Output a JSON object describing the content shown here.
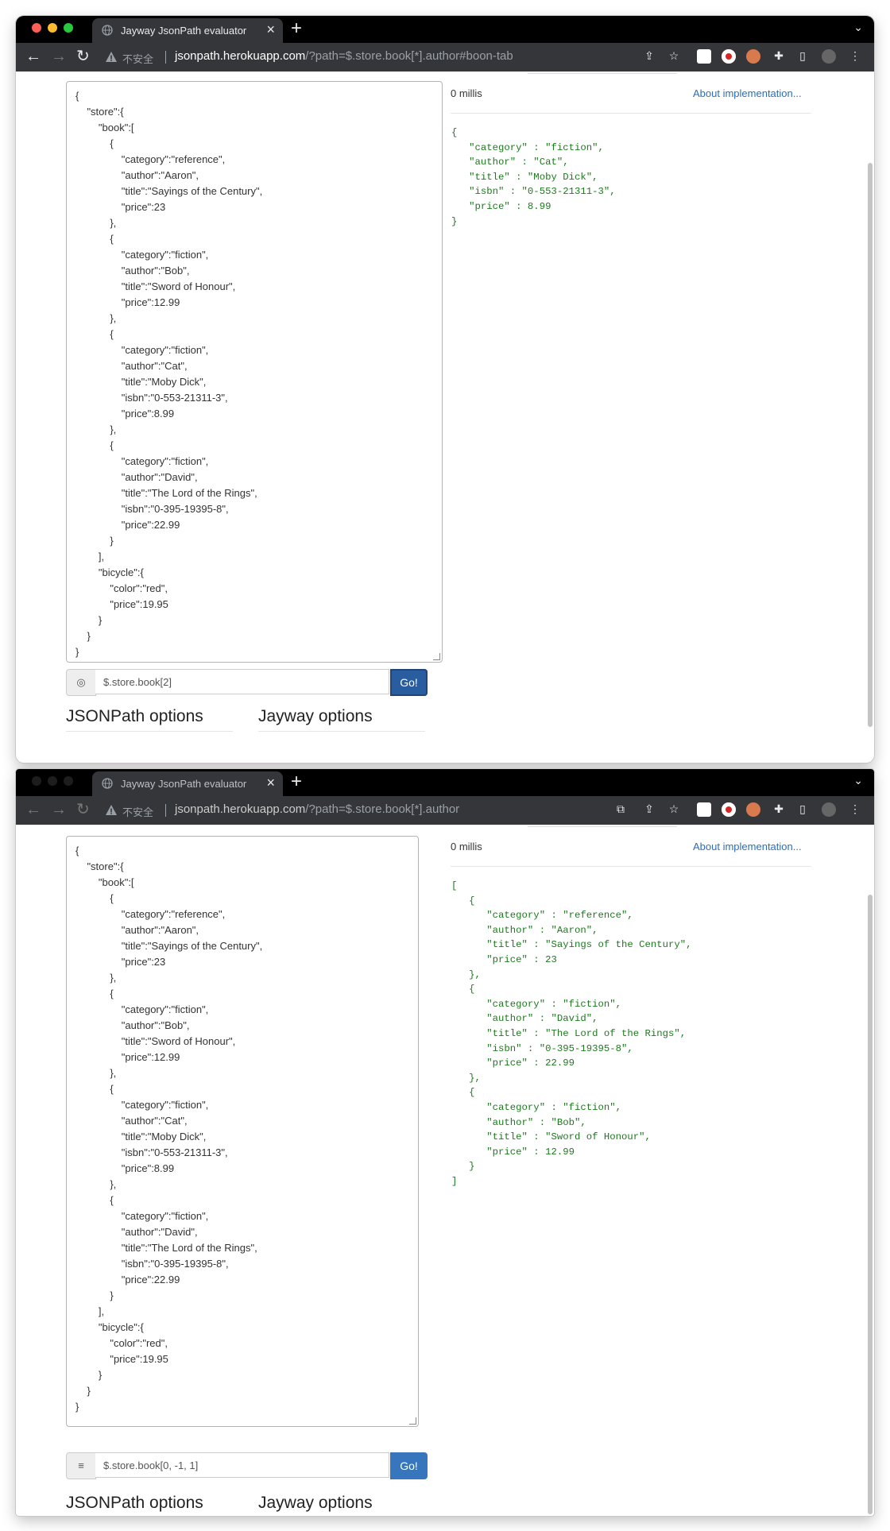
{
  "colors": {
    "close": "#fe5f57",
    "minimize": "#febc2e",
    "maximize": "#28c840",
    "link": "#2a6ebb",
    "result_text": "#1d7a1d",
    "button": "#3776bd"
  },
  "windows": [
    {
      "tab_title": "Jayway JsonPath evaluator",
      "url_security": "不安全",
      "url_host": "jsonpath.herokuapp.com",
      "url_path": "/?path=$.store.book[*].author#boon-tab",
      "json_input": "{\n    \"store\":{\n        \"book\":[\n            {\n                \"category\":\"reference\",\n                \"author\":\"Aaron\",\n                \"title\":\"Sayings of the Century\",\n                \"price\":23\n            },\n            {\n                \"category\":\"fiction\",\n                \"author\":\"Bob\",\n                \"title\":\"Sword of Honour\",\n                \"price\":12.99\n            },\n            {\n                \"category\":\"fiction\",\n                \"author\":\"Cat\",\n                \"title\":\"Moby Dick\",\n                \"isbn\":\"0-553-21311-3\",\n                \"price\":8.99\n            },\n            {\n                \"category\":\"fiction\",\n                \"author\":\"David\",\n                \"title\":\"The Lord of the Rings\",\n                \"isbn\":\"0-395-19395-8\",\n                \"price\":22.99\n            }\n        ],\n        \"bicycle\":{\n            \"color\":\"red\",\n            \"price\":19.95\n        }\n    }\n}",
      "query_icon": "◎",
      "query": "$.store.book[2]",
      "go_label": "Go!",
      "millis": "0 millis",
      "about_link": "About implementation...",
      "result": "{\n   \"category\" : \"fiction\",\n   \"author\" : \"Cat\",\n   \"title\" : \"Moby Dick\",\n   \"isbn\" : \"0-553-21311-3\",\n   \"price\" : 8.99\n}",
      "jsonpath_options": "JSONPath options",
      "jayway_options": "Jayway options"
    },
    {
      "tab_title": "Jayway JsonPath evaluator",
      "url_security": "不安全",
      "url_host": "jsonpath.herokuapp.com",
      "url_path": "/?path=$.store.book[*].author",
      "json_input": "{\n    \"store\":{\n        \"book\":[\n            {\n                \"category\":\"reference\",\n                \"author\":\"Aaron\",\n                \"title\":\"Sayings of the Century\",\n                \"price\":23\n            },\n            {\n                \"category\":\"fiction\",\n                \"author\":\"Bob\",\n                \"title\":\"Sword of Honour\",\n                \"price\":12.99\n            },\n            {\n                \"category\":\"fiction\",\n                \"author\":\"Cat\",\n                \"title\":\"Moby Dick\",\n                \"isbn\":\"0-553-21311-3\",\n                \"price\":8.99\n            },\n            {\n                \"category\":\"fiction\",\n                \"author\":\"David\",\n                \"title\":\"The Lord of the Rings\",\n                \"isbn\":\"0-395-19395-8\",\n                \"price\":22.99\n            }\n        ],\n        \"bicycle\":{\n            \"color\":\"red\",\n            \"price\":19.95\n        }\n    }\n}",
      "query_icon": "≡",
      "query": "$.store.book[0, -1, 1]",
      "go_label": "Go!",
      "millis": "0 millis",
      "about_link": "About implementation...",
      "result": "[\n   {\n      \"category\" : \"reference\",\n      \"author\" : \"Aaron\",\n      \"title\" : \"Sayings of the Century\",\n      \"price\" : 23\n   },\n   {\n      \"category\" : \"fiction\",\n      \"author\" : \"David\",\n      \"title\" : \"The Lord of the Rings\",\n      \"isbn\" : \"0-395-19395-8\",\n      \"price\" : 22.99\n   },\n   {\n      \"category\" : \"fiction\",\n      \"author\" : \"Bob\",\n      \"title\" : \"Sword of Honour\",\n      \"price\" : 12.99\n   }\n]",
      "jsonpath_options": "JSONPath options",
      "jayway_options": "Jayway options"
    }
  ]
}
